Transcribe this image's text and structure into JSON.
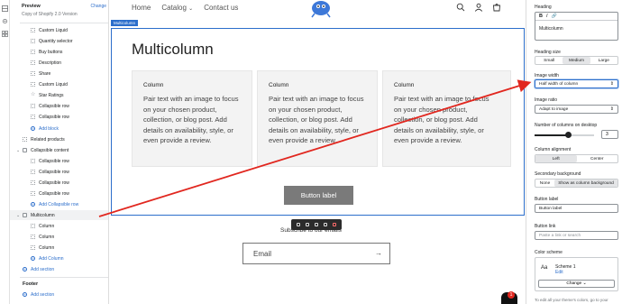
{
  "sidebar": {
    "preview_label": "Preview",
    "change_label": "Change",
    "version": "Copy of Shopify 2.0 Version",
    "blocks": [
      {
        "label": "Custom Liquid",
        "icon": "block-icon"
      },
      {
        "label": "Quantity selector",
        "icon": "block-icon"
      },
      {
        "label": "Buy buttons",
        "icon": "block-icon"
      },
      {
        "label": "Description",
        "icon": "block-icon"
      },
      {
        "label": "Share",
        "icon": "block-icon"
      },
      {
        "label": "Custom Liquid",
        "icon": "block-icon"
      },
      {
        "label": "Star Ratings",
        "icon": "star-icon"
      },
      {
        "label": "Collapsible row",
        "icon": "block-icon"
      },
      {
        "label": "Collapsible row",
        "icon": "block-icon"
      }
    ],
    "add_block": "Add block",
    "related_products": "Related products",
    "collapsible_content": "Collapsible content",
    "collapsible_rows": [
      "Collapsible row",
      "Collapsible row",
      "Collapsible row",
      "Collapsible row"
    ],
    "add_collapsible_row": "Add Collapsible row",
    "multicolumn": "Multicolumn",
    "columns": [
      "Column",
      "Column",
      "Column"
    ],
    "add_column": "Add Column",
    "add_section": "Add section",
    "footer_label": "Footer",
    "footer_add_section": "Add section"
  },
  "canvas": {
    "nav": [
      "Home",
      "Catalog",
      "Contact us"
    ],
    "nav_caret": "⌄",
    "section_tag": "Multicolumn",
    "heading": "Multicolumn",
    "columns": [
      {
        "title": "Column",
        "body": "Pair text with an image to focus on your chosen product, collection, or blog post. Add details on availability, style, or even provide a review."
      },
      {
        "title": "Column",
        "body": "Pair text with an image to focus on your chosen product, collection, or blog post. Add details on availability, style, or even provide a review."
      },
      {
        "title": "Column",
        "body": "Pair text with an image to focus on your chosen product, collection, or blog post. Add details on availability, style, or even provide a review."
      }
    ],
    "button_label": "Button label",
    "subscribe": "Subscribe to our emails",
    "email_placeholder": "Email",
    "email_arrow": "→",
    "chat_badge": "1"
  },
  "panel": {
    "heading_label": "Heading",
    "rte_buttons": [
      "B",
      "I",
      "🔗"
    ],
    "heading_value": "Multicolumn",
    "heading_size_label": "Heading size",
    "heading_sizes": [
      "Small",
      "Medium",
      "Large"
    ],
    "heading_size_selected": 1,
    "image_width_label": "Image width",
    "image_width_value": "Half width of column",
    "image_ratio_label": "Image ratio",
    "image_ratio_value": "Adapt to image",
    "columns_desktop_label": "Number of columns on desktop",
    "columns_desktop_value": "3",
    "columns_desktop_fraction": 0.57,
    "column_alignment_label": "Column alignment",
    "alignments": [
      "Left",
      "Center"
    ],
    "alignment_selected": 0,
    "secondary_bg_label": "Secondary background",
    "secondary_bg_options": [
      "None",
      "Show as column background"
    ],
    "button_label_label": "Button label",
    "button_label_value": "Button label",
    "button_link_label": "Button link",
    "button_link_placeholder": "Paste a link or search",
    "color_scheme_label": "Color scheme",
    "scheme_preview": "Aa",
    "scheme_name": "Scheme 1",
    "scheme_edit": "Edit",
    "scheme_change": "Change",
    "footer_note": "To edit all your theme's colors, go to your"
  },
  "colors": {
    "accent": "#2c6ecb",
    "annotation_arrow": "#e1271f",
    "button_bg": "#7a7a7a"
  }
}
